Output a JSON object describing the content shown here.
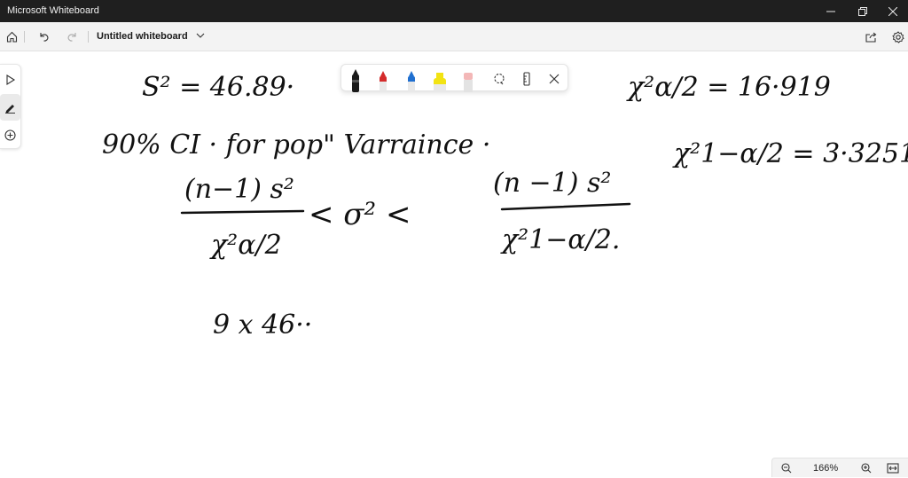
{
  "window": {
    "title": "Microsoft Whiteboard",
    "controls": [
      "minimize-icon",
      "restore-icon",
      "close-icon"
    ]
  },
  "toolbar": {
    "board_name": "Untitled whiteboard",
    "icons": [
      "home-icon",
      "undo-icon",
      "redo-icon",
      "chevron-down-icon",
      "share-icon",
      "settings-icon"
    ]
  },
  "left_tools": [
    "select-icon",
    "pen-icon",
    "add-icon"
  ],
  "pen_tray": {
    "tools": [
      {
        "name": "black-pen",
        "color": "#1a1a1a"
      },
      {
        "name": "red-pen",
        "color": "#d42b2b"
      },
      {
        "name": "blue-pen",
        "color": "#1f6fd0"
      },
      {
        "name": "yellow-highlighter",
        "color": "#f2e313"
      },
      {
        "name": "eraser",
        "color": "#f3b7b7"
      }
    ],
    "icons": [
      "lasso-icon",
      "ruler-icon",
      "close-icon"
    ]
  },
  "ink_text": {
    "s_squared": "S² = 46.89·",
    "chi_alpha_half": "χ²α/2 = 16·919",
    "ci_heading": "90% CI · for pop\" Varraince ·",
    "chi_one_minus": "χ²1−α/2 = 3·3251",
    "lower_numerator": "(n−1) s²",
    "lower_denominator": "χ²α/2",
    "inequality_middle": "< σ² <",
    "upper_numerator": "(n −1) s²",
    "upper_denominator": "χ²1−α/2.",
    "work_line": "9 x 46··"
  },
  "zoom": {
    "value": "166%",
    "icons": [
      "zoom-out-icon",
      "zoom-in-icon",
      "fit-icon"
    ]
  },
  "colors": {
    "titlebar": "#1f1f1f",
    "toolbar": "#f3f3f3",
    "ink": "#111111"
  }
}
